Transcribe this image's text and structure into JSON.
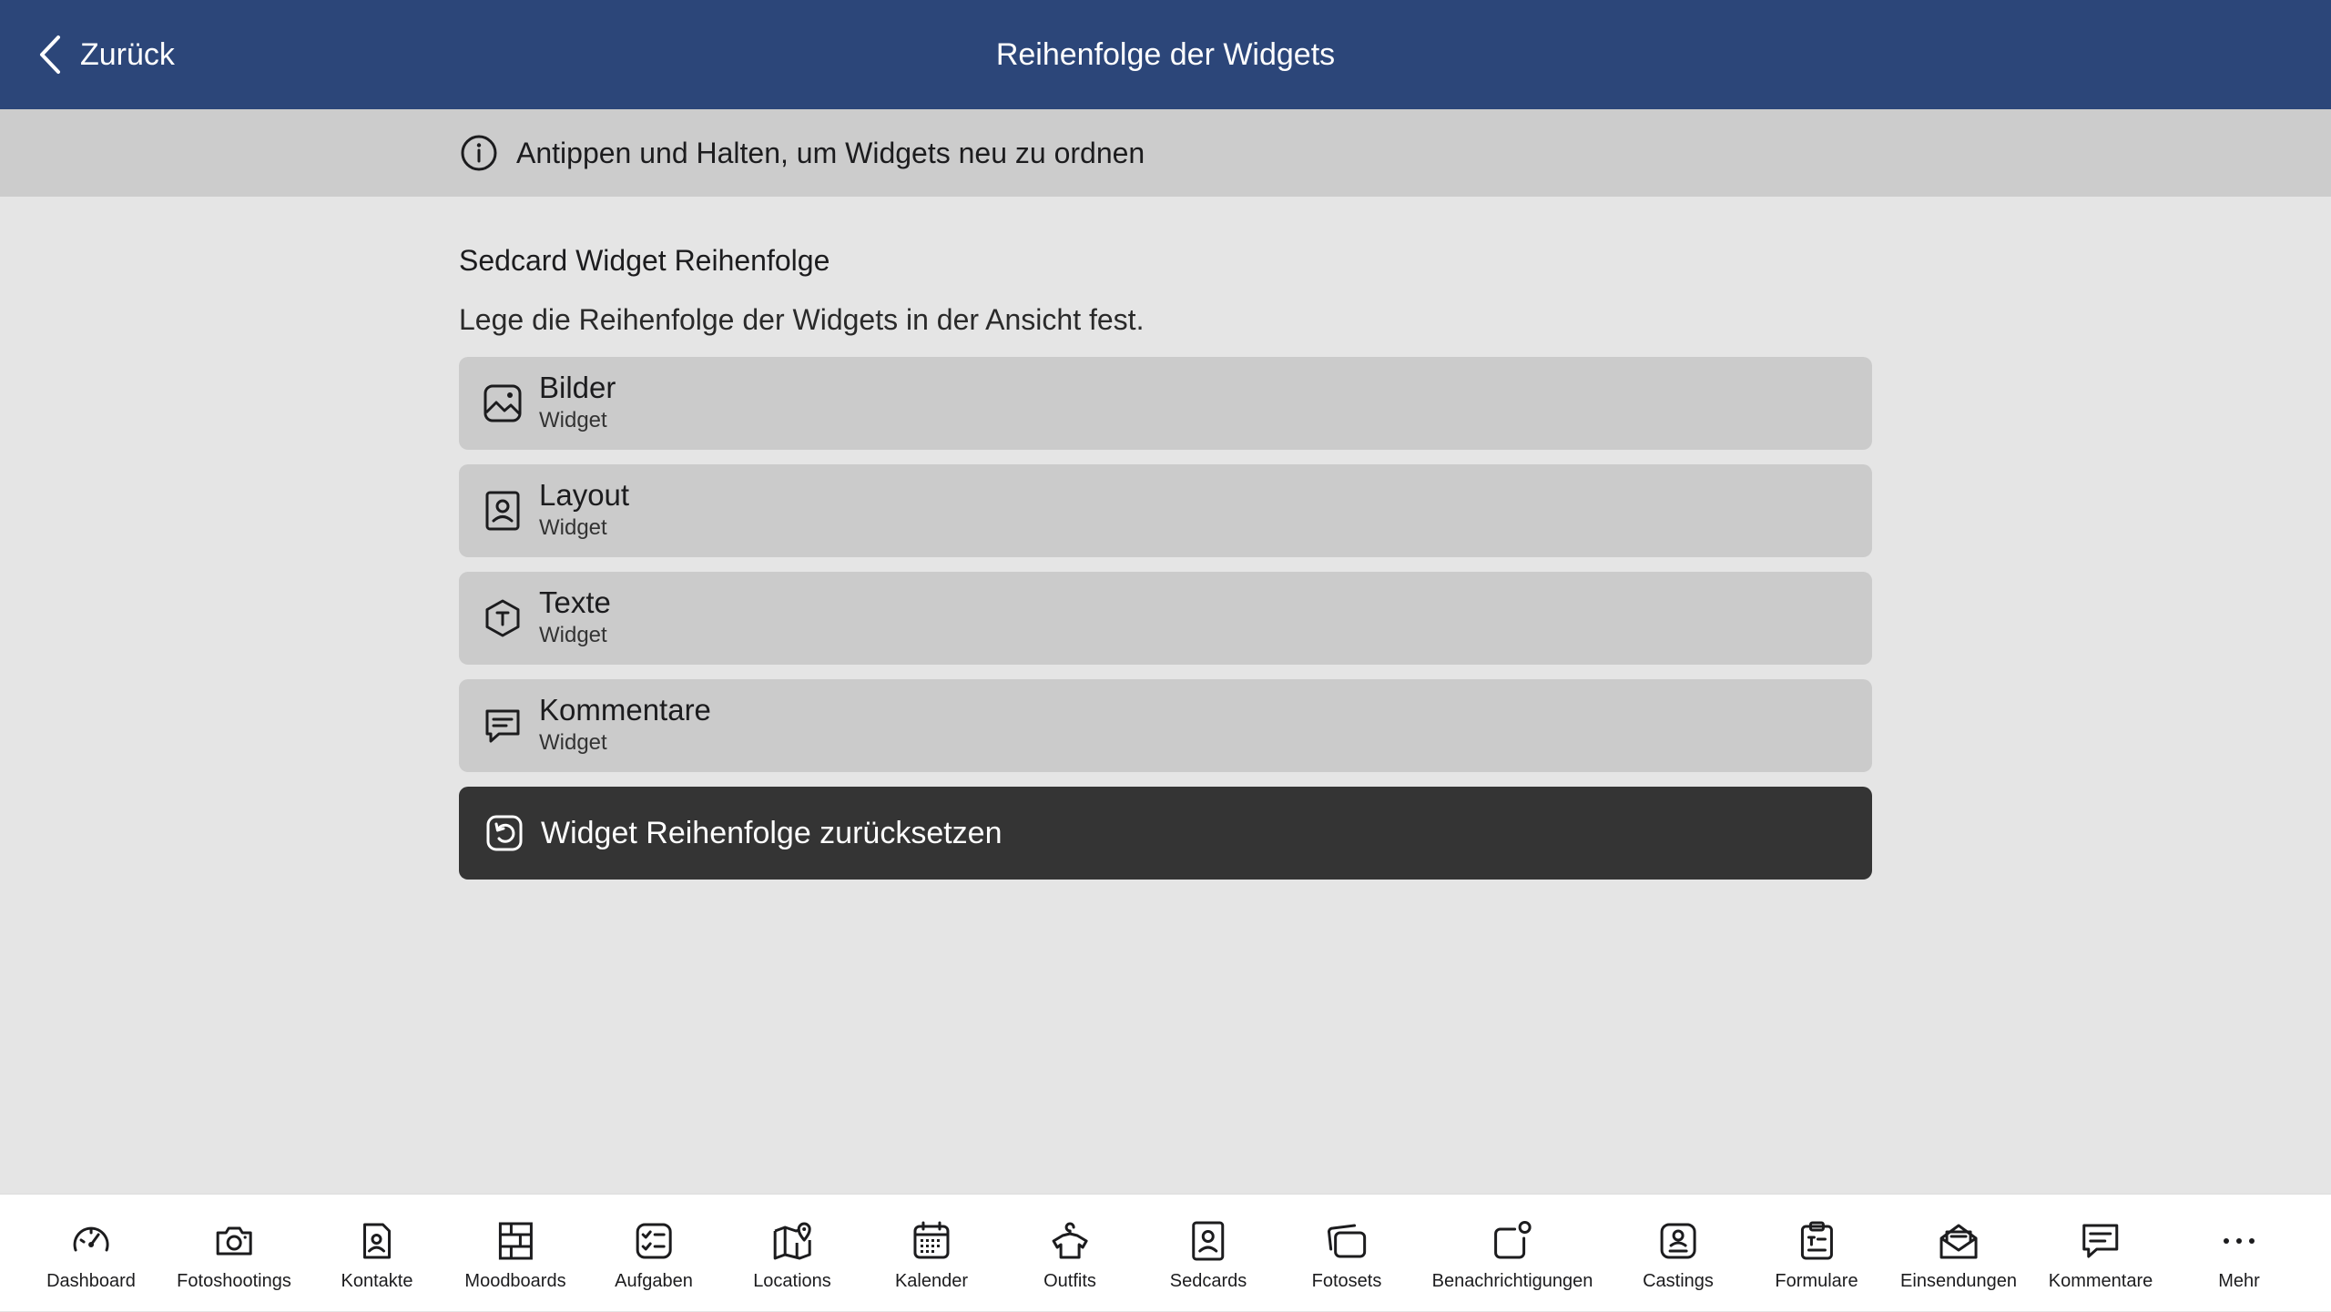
{
  "header": {
    "back_label": "Zurück",
    "title": "Reihenfolge der Widgets"
  },
  "info": {
    "text": "Antippen und Halten, um Widgets neu zu ordnen"
  },
  "section": {
    "title": "Sedcard Widget Reihenfolge",
    "description": "Lege die Reihenfolge der Widgets in der Ansicht fest."
  },
  "widgets": [
    {
      "label": "Bilder",
      "sublabel": "Widget",
      "icon": "image-icon"
    },
    {
      "label": "Layout",
      "sublabel": "Widget",
      "icon": "portrait-icon"
    },
    {
      "label": "Texte",
      "sublabel": "Widget",
      "icon": "text-hexagon-icon"
    },
    {
      "label": "Kommentare",
      "sublabel": "Widget",
      "icon": "comment-icon"
    }
  ],
  "reset_button": {
    "label": "Widget Reihenfolge zurücksetzen",
    "icon": "reset-icon"
  },
  "bottom_nav": [
    {
      "label": "Dashboard",
      "icon": "speedometer-icon"
    },
    {
      "label": "Fotoshootings",
      "icon": "camera-icon"
    },
    {
      "label": "Kontakte",
      "icon": "contact-icon"
    },
    {
      "label": "Moodboards",
      "icon": "moodboard-icon"
    },
    {
      "label": "Aufgaben",
      "icon": "checklist-icon"
    },
    {
      "label": "Locations",
      "icon": "map-pin-icon"
    },
    {
      "label": "Kalender",
      "icon": "calendar-icon"
    },
    {
      "label": "Outfits",
      "icon": "shirt-icon"
    },
    {
      "label": "Sedcards",
      "icon": "portrait-icon"
    },
    {
      "label": "Fotosets",
      "icon": "photoset-icon"
    },
    {
      "label": "Benachrichtigungen",
      "icon": "notification-icon"
    },
    {
      "label": "Castings",
      "icon": "casting-icon"
    },
    {
      "label": "Formulare",
      "icon": "clipboard-icon"
    },
    {
      "label": "Einsendungen",
      "icon": "envelope-icon"
    },
    {
      "label": "Kommentare",
      "icon": "comment-icon"
    },
    {
      "label": "Mehr",
      "icon": "more-icon"
    }
  ],
  "colors": {
    "header_bg": "#2c4679",
    "info_bg": "#cccccc",
    "page_bg": "#e5e5e5",
    "widget_bg": "#cbcbcb",
    "reset_bg": "#343434",
    "nav_bg": "#ffffff"
  }
}
